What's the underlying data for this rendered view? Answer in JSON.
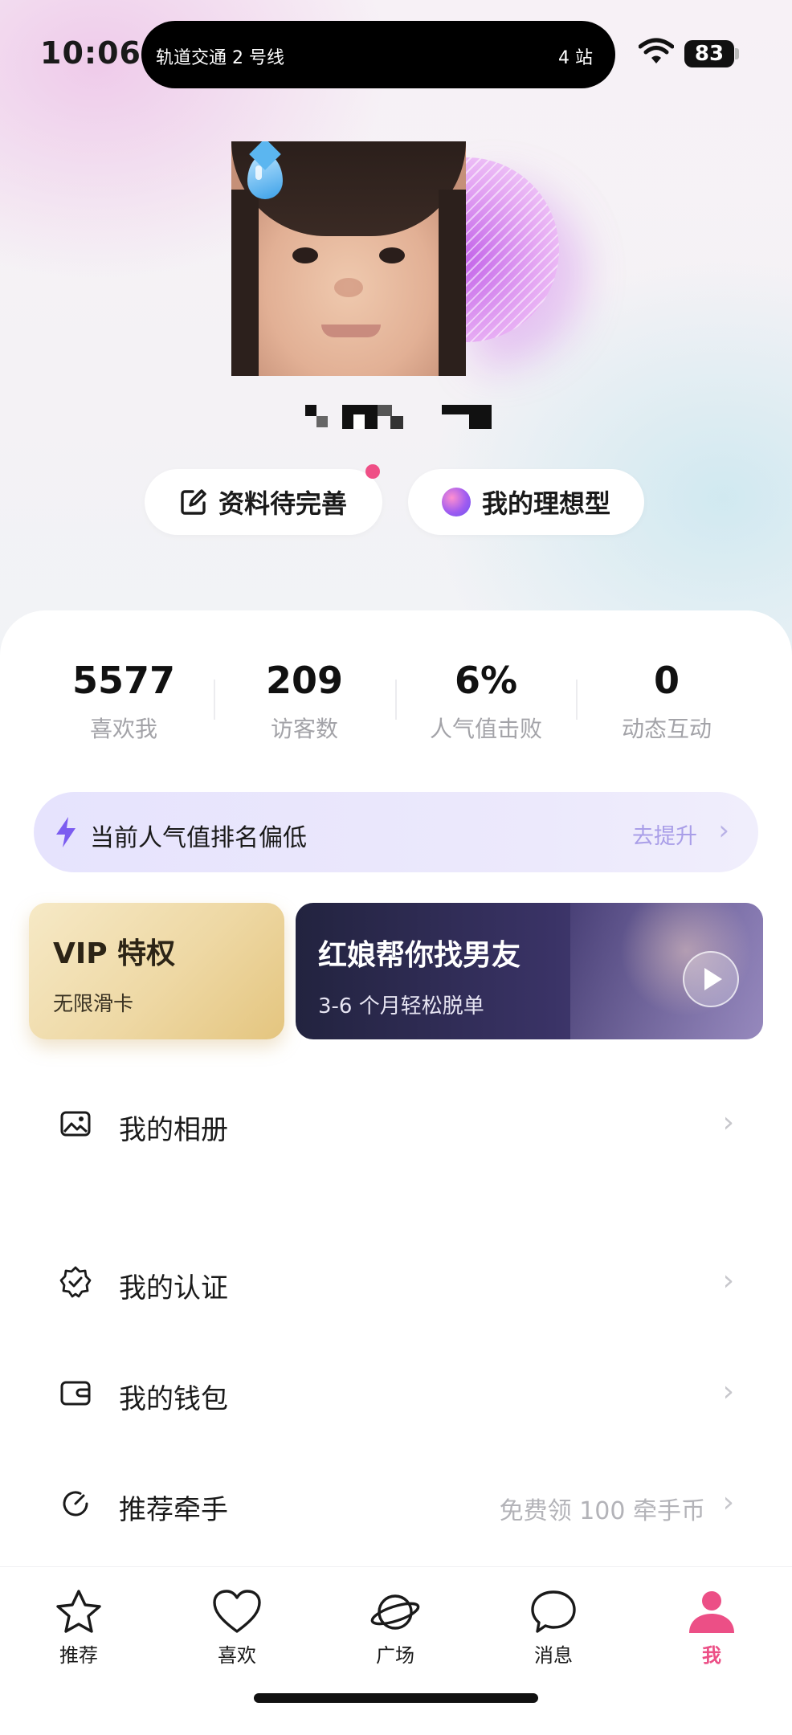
{
  "status_bar": {
    "time": "10:06",
    "live_activity": {
      "line": "轨道交通 2 号线",
      "stops": "4 站"
    },
    "battery": "83"
  },
  "profile": {
    "tag_edit": "资料待完善",
    "tag_ideal": "我的理想型"
  },
  "stats": [
    {
      "value": "5577",
      "label": "喜欢我"
    },
    {
      "value": "209",
      "label": "访客数"
    },
    {
      "value": "6%",
      "label": "人气值击败"
    },
    {
      "value": "0",
      "label": "动态互动"
    }
  ],
  "rank_banner": {
    "text": "当前人气值排名偏低",
    "action": "去提升"
  },
  "promos": {
    "vip": {
      "title": "VIP 特权",
      "subtitle": "无限滑卡"
    },
    "matchmaker": {
      "title": "红娘帮你找男友",
      "subtitle": "3-6 个月轻松脱单"
    }
  },
  "menu": {
    "album": {
      "label": "我的相册",
      "icon": "image-icon"
    },
    "verify": {
      "label": "我的认证",
      "icon": "badge-check-icon"
    },
    "wallet": {
      "label": "我的钱包",
      "icon": "wallet-icon"
    },
    "referral": {
      "label": "推荐牵手",
      "extra": "免费领 100 牵手币",
      "icon": "refresh-icon"
    }
  },
  "tabbar": [
    {
      "label": "推荐",
      "icon": "star-icon"
    },
    {
      "label": "喜欢",
      "icon": "heart-icon"
    },
    {
      "label": "广场",
      "icon": "planet-icon"
    },
    {
      "label": "消息",
      "icon": "chat-bubble-icon"
    },
    {
      "label": "我",
      "icon": "person-icon",
      "active": true
    }
  ],
  "colors": {
    "accent": "#ec4f86",
    "rank_bg": "#e8e5fc",
    "vip_gold": "#eed8a4",
    "match_dark": "#2a2a4a"
  }
}
